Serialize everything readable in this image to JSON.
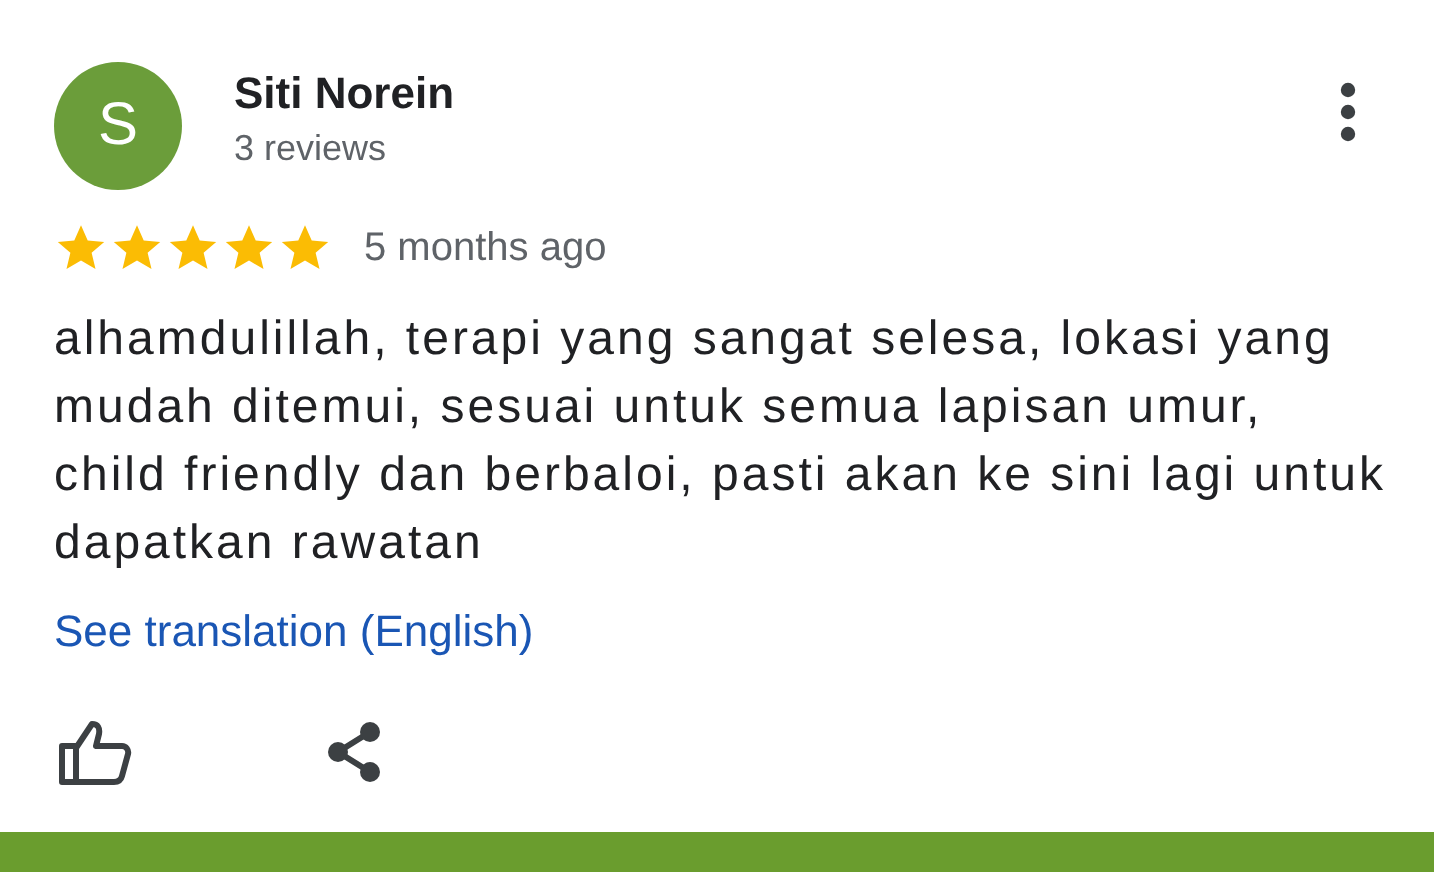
{
  "review": {
    "avatar_letter": "S",
    "author": "Siti Norein",
    "review_count": "3 reviews",
    "stars": 5,
    "time": "5 months ago",
    "text": "alhamdulillah, terapi yang sangat selesa, lokasi yang mudah ditemui, sesuai untuk semua lapisan umur, child friendly dan berbaloi, pasti akan ke sini lagi untuk dapatkan rawatan",
    "translation_link": "See translation (English)"
  }
}
